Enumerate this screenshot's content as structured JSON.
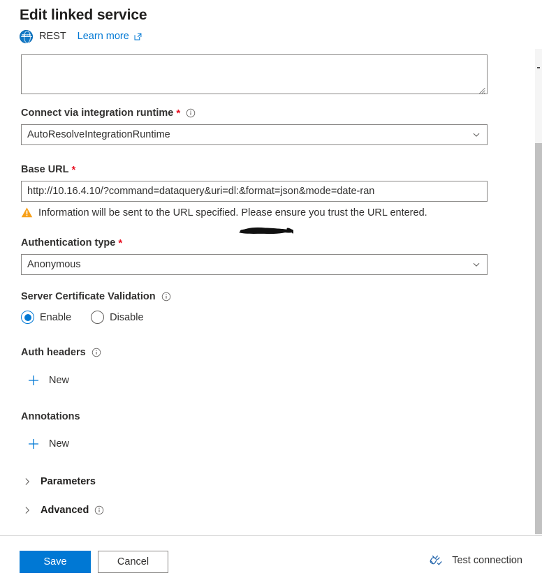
{
  "header": {
    "title": "Edit linked service",
    "type_label": "REST",
    "type_icon_text": "REST",
    "learn_more": "Learn more"
  },
  "form": {
    "description_value": "",
    "integration_runtime": {
      "label": "Connect via integration runtime",
      "required_marker": "*",
      "value": "AutoResolveIntegrationRuntime"
    },
    "base_url": {
      "label": "Base URL",
      "required_marker": "*",
      "value_prefix": "http://10.16.4.10/?command=dataquery&uri=dl:",
      "value_suffix": "&format=json&mode=date-ran",
      "warning": "Information will be sent to the URL specified. Please ensure you trust the URL entered."
    },
    "auth_type": {
      "label": "Authentication type",
      "required_marker": "*",
      "value": "Anonymous"
    },
    "server_cert_validation": {
      "label": "Server Certificate Validation",
      "options": [
        {
          "label": "Enable",
          "selected": true
        },
        {
          "label": "Disable",
          "selected": false
        }
      ]
    },
    "auth_headers": {
      "label": "Auth headers",
      "new_label": "New"
    },
    "annotations": {
      "label": "Annotations",
      "new_label": "New"
    },
    "parameters": {
      "label": "Parameters"
    },
    "advanced": {
      "label": "Advanced"
    }
  },
  "footer": {
    "save_label": "Save",
    "cancel_label": "Cancel",
    "test_connection_label": "Test connection"
  },
  "colors": {
    "accent": "#0078d4",
    "required": "#e81123",
    "warning": "#f7a01a",
    "border": "#8a8886"
  }
}
